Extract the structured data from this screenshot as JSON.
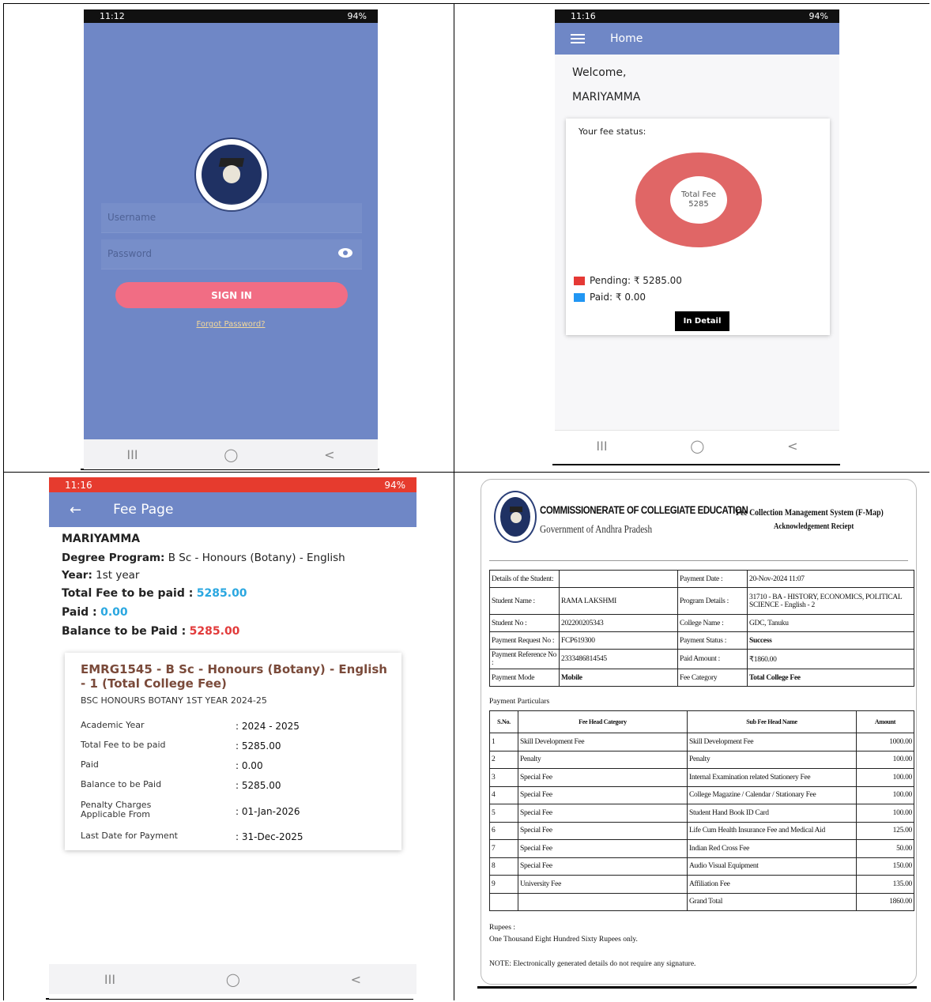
{
  "login": {
    "status_time": "11:12",
    "status_right": "94%",
    "username_placeholder": "Username",
    "password_placeholder": "Password",
    "signin_label": "SIGN IN",
    "forgot_label": "Forgot Password?",
    "nav": [
      "III",
      "◯",
      "<"
    ]
  },
  "home": {
    "status_time": "11:16",
    "status_right": "94%",
    "title": "Home",
    "welcome": "Welcome,",
    "user": "MARIYAMMA",
    "card_title": "Your fee status:",
    "donut_label": "Total Fee",
    "donut_value": "5285",
    "pending_label": "Pending:",
    "pending_value": "₹ 5285.00",
    "paid_label": "Paid:",
    "paid_value": "₹ 0.00",
    "pending_color": "#e53935",
    "paid_color": "#2196f3",
    "detail_button": "In Detail",
    "nav": [
      "III",
      "◯",
      "<"
    ]
  },
  "fee_page": {
    "status_time": "11:16",
    "status_right": "94%",
    "title": "Fee Page",
    "back_icon": "←",
    "student": "MARIYAMMA",
    "degree_label": "Degree Program:",
    "degree_value": "B Sc - Honours (Botany) - English",
    "year_label": "Year:",
    "year_value": "1st year",
    "total_label": "Total Fee to be paid :",
    "total_value": "5285.00",
    "paid_label": "Paid :",
    "paid_value": "0.00",
    "balance_label": "Balance to be Paid :",
    "balance_value": "5285.00",
    "card_title": "EMRG1545 - B Sc - Honours (Botany) - English - 1 (Total College Fee)",
    "card_subtitle": "BSC HONOURS BOTANY 1ST YEAR 2024-25",
    "rows": [
      {
        "k": "Academic Year",
        "v": ": 2024 - 2025"
      },
      {
        "k": "Total Fee to be paid",
        "v": ": 5285.00"
      },
      {
        "k": "Paid",
        "v": ": 0.00"
      },
      {
        "k": "Balance to be Paid",
        "v": ": 5285.00"
      },
      {
        "k": "Penalty Charges Applicable From",
        "v": ": 01-Jan-2026"
      },
      {
        "k": "Last Date for Payment",
        "v": ": 31-Dec-2025"
      }
    ],
    "nav": [
      "III",
      "◯",
      "<"
    ]
  },
  "receipt": {
    "org": "COMMISSIONERATE OF COLLEGIATE EDUCATION",
    "gov": "Government of Andhra Pradesh",
    "system": "Fee Collection Management System (F-Map)",
    "doc": "Acknowledgement Reciept",
    "details": [
      [
        "Details of the Student:",
        "",
        "Payment Date :",
        "20-Nov-2024 11:07"
      ],
      [
        "Student Name :",
        "RAMA LAKSHMI",
        "Program Details :",
        "31710 - BA - HISTORY, ECONOMICS, POLITICAL SCIENCE - English - 2"
      ],
      [
        "Student No :",
        "202200205343",
        "College Name :",
        "GDC, Tanuku"
      ],
      [
        "Payment Request No :",
        "FCP619300",
        "Payment Status :",
        "Success"
      ],
      [
        "Payment Reference No :",
        "2333486814545",
        "Paid Amount :",
        "₹1860.00"
      ],
      [
        "Payment Mode",
        "Mobile",
        "Fee Category",
        "Total College Fee"
      ]
    ],
    "particulars_label": "Payment Particulars",
    "fee_headers": [
      "S.No.",
      "Fee Head Category",
      "Sub Fee Head Name",
      "Amount"
    ],
    "fee_rows": [
      [
        "1",
        "Skill Development Fee",
        "Skill Development Fee",
        "1000.00"
      ],
      [
        "2",
        "Penalty",
        "Penalty",
        "100.00"
      ],
      [
        "3",
        "Special Fee",
        "Internal Examination related Stationery Fee",
        "100.00"
      ],
      [
        "4",
        "Special Fee",
        "College Magazine / Calendar / Stationary Fee",
        "100.00"
      ],
      [
        "5",
        "Special Fee",
        "Student Hand Book ID Card",
        "100.00"
      ],
      [
        "6",
        "Special Fee",
        "Life Cum Health Insurance Fee and Medical Aid",
        "125.00"
      ],
      [
        "7",
        "Special Fee",
        "Indian Red Cross Fee",
        "50.00"
      ],
      [
        "8",
        "Special Fee",
        "Audio Visual Equipment",
        "150.00"
      ],
      [
        "9",
        "University Fee",
        "Affiliation Fee",
        "135.00"
      ],
      [
        "",
        "",
        "Grand Total",
        "1860.00"
      ]
    ],
    "rupees_label": "Rupees :",
    "rupees_value": "One Thousand Eight Hundred Sixty Rupees only.",
    "note": "NOTE: Electronically generated details do not require any signature."
  }
}
